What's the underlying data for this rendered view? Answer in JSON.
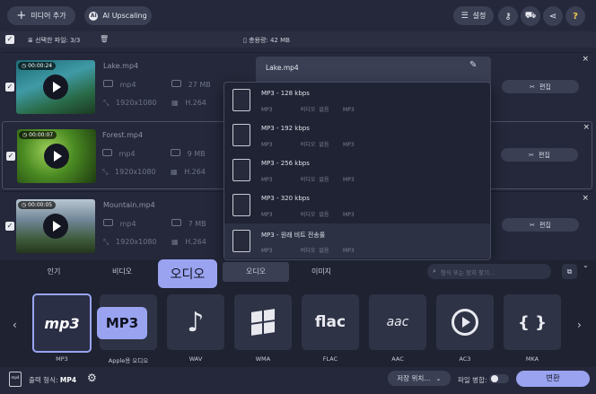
{
  "toolbar": {
    "add_media_label": "미디어 추가",
    "ai_upscaling_label": "AI Upscaling",
    "settings_label": "설정"
  },
  "selection": {
    "selected_label": "선택한 파일: 3/3",
    "total_size_label": "총용량: 42 MB"
  },
  "files": [
    {
      "name": "Lake.mp4",
      "duration": "00:00:24",
      "format": "mp4",
      "size": "27 MB",
      "resolution": "1920x1080",
      "codec": "H.264",
      "edit_label": "편집"
    },
    {
      "name": "Forest.mp4",
      "duration": "00:00:07",
      "format": "mp4",
      "size": "9 MB",
      "resolution": "1920x1080",
      "codec": "H.264",
      "edit_label": "편집"
    },
    {
      "name": "Mountain.mp4",
      "duration": "00:00:05",
      "format": "mp4",
      "size": "7 MB",
      "resolution": "1920x1080",
      "codec": "H.264",
      "edit_label": "편집"
    }
  ],
  "output_panel": {
    "filename": "Lake.mp4"
  },
  "dropdown": {
    "items": [
      {
        "title": "MP3 - 128 kbps",
        "c1": "MP3",
        "c2": "비디오 없음",
        "c3": "MP3"
      },
      {
        "title": "MP3 - 192 kbps",
        "c1": "MP3",
        "c2": "비디오 없음",
        "c3": "MP3"
      },
      {
        "title": "MP3 - 256 kbps",
        "c1": "MP3",
        "c2": "비디오 없음",
        "c3": "MP3"
      },
      {
        "title": "MP3 - 320 kbps",
        "c1": "MP3",
        "c2": "비디오 없음",
        "c3": "MP3"
      },
      {
        "title": "MP3 - 원래 비트 전송률",
        "c1": "MP3",
        "c2": "비디오 없음",
        "c3": "MP3"
      }
    ]
  },
  "format_tabs": [
    "인기",
    "비디오",
    "오디오",
    "오디오",
    "이미지"
  ],
  "search": {
    "placeholder": "형식 또는 장치 찾기..."
  },
  "callouts": {
    "audio": "오디오",
    "mp3": "MP3"
  },
  "formats": [
    {
      "label": "MP3",
      "icon": "mp3-icon",
      "glyph": "mp3"
    },
    {
      "label": "Apple용 오디오",
      "icon": "apple-audio-icon",
      "glyph": ""
    },
    {
      "label": "WAV",
      "icon": "wav-note-icon",
      "glyph": "♪"
    },
    {
      "label": "WMA",
      "icon": "windows-logo-icon",
      "glyph": ""
    },
    {
      "label": "FLAC",
      "icon": "flac-icon",
      "glyph": "flac"
    },
    {
      "label": "AAC",
      "icon": "aac-icon",
      "glyph": "aac"
    },
    {
      "label": "AC3",
      "icon": "ac3-play-icon",
      "glyph": ""
    },
    {
      "label": "MKA",
      "icon": "mka-icon",
      "glyph": "{ }"
    }
  ],
  "footer": {
    "output_format_label": "출력 형식:",
    "output_format_value": "MP4",
    "save_location_label": "저장 위치...",
    "merge_files_label": "파일 병합:",
    "convert_label": "변환"
  },
  "colors": {
    "accent": "#9aa3f0",
    "background": "#24283a"
  }
}
